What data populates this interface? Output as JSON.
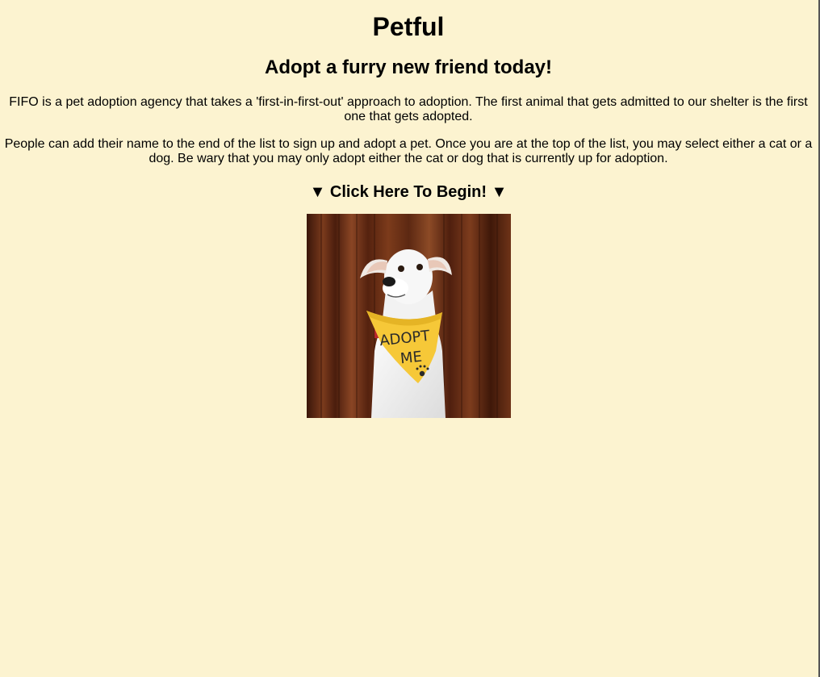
{
  "header": {
    "title": "Petful",
    "subtitle": "Adopt a furry new friend today!"
  },
  "intro": {
    "paragraph1": "FIFO is a pet adoption agency that takes a 'first-in-first-out' approach to adoption. The first animal that gets admitted to our shelter is the first one that gets adopted.",
    "paragraph2": "People can add their name to the end of the list to sign up and adopt a pet. Once you are at the top of the list, you may select either a cat or a dog. Be wary that you may only adopt either the cat or dog that is currently up for adoption."
  },
  "cta": {
    "label": "▼ Click Here To Begin! ▼"
  },
  "photo": {
    "alt": "white dog wearing yellow Adopt Me bandana",
    "bandana_text_line1": "ADOPT",
    "bandana_text_line2": "ME"
  },
  "colors": {
    "background": "#fcf3d0",
    "text": "#000000",
    "bandana": "#f6c838",
    "wood": "#6a3218"
  }
}
